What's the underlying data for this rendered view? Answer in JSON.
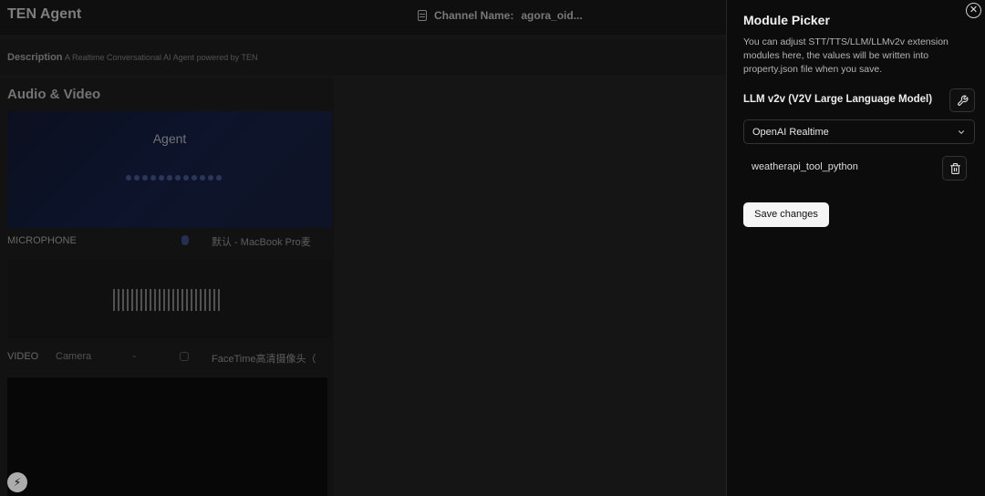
{
  "app": {
    "title": "TEN Agent",
    "channel_label": "Channel Name:",
    "channel_value": "agora_oid...",
    "description_label": "Description",
    "description_text": "A Realtime Conversational AI Agent powered by TEN",
    "section_title": "Audio & Video",
    "agent_label": "Agent",
    "microphone_label": "MICROPHONE",
    "microphone_device": "默认 - MacBook Pro麦",
    "video_label": "VIDEO",
    "video_source": "Camera",
    "video_device": "FaceTime高清摄像头（"
  },
  "sheet": {
    "title": "Module Picker",
    "description": "You can adjust STT/TTS/LLM/LLMv2v extension modules here, the values will be written into property.json file when you save.",
    "module_label": "LLM v2v (V2V Large Language Model)",
    "selected_module": "OpenAI Realtime",
    "tools": [
      {
        "name": "weatherapi_tool_python"
      }
    ],
    "save_label": "Save changes"
  },
  "colors": {
    "sheet_bg": "#0c0c0c",
    "save_button_bg": "#f5f5f5",
    "agent_gradient": "#121b3a"
  },
  "icons": [
    "document-icon",
    "close-icon",
    "wrench-icon",
    "chevron-down-icon",
    "trash-icon",
    "microphone-icon",
    "camera-off-icon",
    "bolt-icon"
  ]
}
